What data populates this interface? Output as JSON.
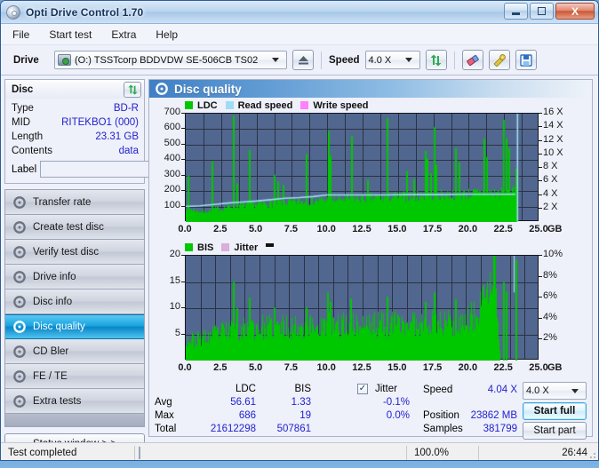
{
  "window": {
    "title": "Opti Drive Control 1.70",
    "icon": "disc-icon",
    "minimize": "–",
    "maximize": "□",
    "close": "X"
  },
  "menu": [
    "File",
    "Start test",
    "Extra",
    "Help"
  ],
  "toolbar": {
    "drive_label": "Drive",
    "drive_value": "(O:)  TSSTcorp BDDVDW SE-506CB TS02",
    "eject_icon": "eject-icon",
    "speed_label": "Speed",
    "speed_value": "4.0 X",
    "refresh_icon": "refresh-icon",
    "eraser_icon": "eraser-icon",
    "tools_icon": "tools-icon",
    "save_icon": "save-icon"
  },
  "disc_panel": {
    "header": "Disc",
    "refresh_icon": "refresh-icon",
    "rows": [
      {
        "key": "Type",
        "value": "BD-R"
      },
      {
        "key": "MID",
        "value": "RITEKBO1 (000)"
      },
      {
        "key": "Length",
        "value": "23.31 GB"
      },
      {
        "key": "Contents",
        "value": "data"
      }
    ],
    "label_key": "Label",
    "label_value": "",
    "label_placeholder": "",
    "label_button_icon": "disc-icon"
  },
  "nav": {
    "items": [
      {
        "label": "Transfer rate",
        "icon": "disc-icon",
        "selected": false
      },
      {
        "label": "Create test disc",
        "icon": "disc-icon",
        "selected": false
      },
      {
        "label": "Verify test disc",
        "icon": "disc-icon",
        "selected": false
      },
      {
        "label": "Drive info",
        "icon": "disc-icon",
        "selected": false
      },
      {
        "label": "Disc info",
        "icon": "disc-icon",
        "selected": false
      },
      {
        "label": "Disc quality",
        "icon": "disc-icon",
        "selected": true
      },
      {
        "label": "CD Bler",
        "icon": "disc-icon",
        "selected": false
      },
      {
        "label": "FE / TE",
        "icon": "disc-icon",
        "selected": false
      },
      {
        "label": "Extra tests",
        "icon": "disc-icon",
        "selected": false
      }
    ],
    "status_window_button": "Status window > >"
  },
  "panel": {
    "title": "Disc quality",
    "icon": "disc-icon"
  },
  "stats": {
    "col_ldc": "LDC",
    "col_bis": "BIS",
    "jitter_label": "Jitter",
    "jitter_checked": true,
    "rows": [
      {
        "name": "Avg",
        "ldc": "56.61",
        "bis": "1.33",
        "jitter": "-0.1%"
      },
      {
        "name": "Max",
        "ldc": "686",
        "bis": "19",
        "jitter": "0.0%"
      },
      {
        "name": "Total",
        "ldc": "21612298",
        "bis": "507861",
        "jitter": ""
      }
    ],
    "speed_label": "Speed",
    "speed_value": "4.04 X",
    "position_label": "Position",
    "position_value": "23862 MB",
    "samples_label": "Samples",
    "samples_value": "381799",
    "speed_select": "4.0 X",
    "start_full": "Start full",
    "start_part": "Start part"
  },
  "statusbar": {
    "text": "Test completed",
    "percent": "100.0%",
    "progress": 100,
    "time": "26:44"
  },
  "colors": {
    "ldc": "#00c800",
    "read_speed": "#9fdcf4",
    "write_speed": "#ff80ff",
    "bis": "#00c800",
    "jitter": "#d9b0d9",
    "plot_bg": "#51678f",
    "grid": "#2a3244",
    "accent": "#2222cc"
  },
  "chart_data": [
    {
      "type": "area",
      "id": "ldc-chart",
      "title": "LDC / Read speed / Write speed",
      "legend": [
        {
          "name": "LDC",
          "color": "#00c800"
        },
        {
          "name": "Read speed",
          "color": "#9fdcf4"
        },
        {
          "name": "Write speed",
          "color": "#ff80ff"
        }
      ],
      "legend_position": "top-left",
      "grid": true,
      "xlabel": "GB",
      "xlim": [
        0,
        25
      ],
      "xticks": [
        "0.0",
        "2.5",
        "5.0",
        "7.5",
        "10.0",
        "12.5",
        "15.0",
        "17.5",
        "20.0",
        "22.5",
        "25.0"
      ],
      "ylabel": "LDC",
      "ylim": [
        0,
        700
      ],
      "yticks": [
        100,
        200,
        300,
        400,
        500,
        600,
        700
      ],
      "y2label": "Speed",
      "y2lim": [
        0,
        16
      ],
      "y2ticks": [
        "2 X",
        "4 X",
        "6 X",
        "8 X",
        "10 X",
        "12 X",
        "14 X",
        "16 X"
      ],
      "data_end_gb": 23.4,
      "series": [
        {
          "name": "LDC",
          "color": "#00c800",
          "baseline": [
            95,
            82,
            70,
            68,
            72,
            80,
            88,
            95,
            100,
            105,
            108,
            112,
            115,
            118,
            120,
            122,
            124,
            126,
            128,
            130,
            132,
            134,
            136,
            138,
            140,
            142,
            144,
            146,
            148,
            150,
            152,
            154,
            155,
            157,
            158,
            160,
            161,
            163,
            164,
            166,
            167,
            169,
            170,
            172,
            173,
            175,
            176,
            178,
            179,
            181,
            182,
            184,
            185,
            186,
            187,
            188,
            189,
            190,
            191,
            192
          ],
          "spikes": [
            {
              "gb": 0.15,
              "value": 300
            },
            {
              "gb": 1.85,
              "value": 392
            },
            {
              "gb": 3.35,
              "value": 688
            },
            {
              "gb": 3.6,
              "value": 250
            },
            {
              "gb": 4.45,
              "value": 465
            },
            {
              "gb": 6.2,
              "value": 305
            },
            {
              "gb": 6.45,
              "value": 262
            },
            {
              "gb": 6.85,
              "value": 240
            },
            {
              "gb": 8.5,
              "value": 440
            },
            {
              "gb": 10.05,
              "value": 588
            },
            {
              "gb": 10.2,
              "value": 430
            },
            {
              "gb": 11.7,
              "value": 555
            },
            {
              "gb": 12.8,
              "value": 275
            },
            {
              "gb": 14.2,
              "value": 672
            },
            {
              "gb": 15.6,
              "value": 330
            },
            {
              "gb": 16.05,
              "value": 280
            },
            {
              "gb": 16.9,
              "value": 460
            },
            {
              "gb": 17.05,
              "value": 410
            },
            {
              "gb": 17.25,
              "value": 315
            },
            {
              "gb": 17.5,
              "value": 612
            },
            {
              "gb": 17.65,
              "value": 370
            },
            {
              "gb": 19.05,
              "value": 478
            },
            {
              "gb": 19.3,
              "value": 385
            },
            {
              "gb": 21.05,
              "value": 540
            },
            {
              "gb": 21.2,
              "value": 420
            },
            {
              "gb": 22.45,
              "value": 660
            },
            {
              "gb": 22.6,
              "value": 540
            },
            {
              "gb": 22.8,
              "value": 478
            },
            {
              "gb": 23.3,
              "value": 345
            }
          ]
        },
        {
          "name": "Read speed",
          "color": "#9fdcf4",
          "values_x_gb": [
            0,
            1,
            2,
            3,
            4,
            5,
            6,
            7,
            8,
            9,
            10,
            11,
            12,
            14,
            16,
            18,
            20,
            22,
            23.3
          ],
          "values_speed_x": [
            2.3,
            2.4,
            2.6,
            2.8,
            2.95,
            3.1,
            3.3,
            3.5,
            3.6,
            3.75,
            4.0,
            4.0,
            4.0,
            4.0,
            4.05,
            4.05,
            4.1,
            4.1,
            4.1
          ],
          "final_vertical_spike_gb": 23.45,
          "final_vertical_spike_speed": 16.0
        },
        {
          "name": "Write speed",
          "color": "#ff80ff",
          "values": []
        }
      ]
    },
    {
      "type": "area",
      "id": "bis-chart",
      "title": "BIS / Jitter",
      "legend": [
        {
          "name": "BIS",
          "color": "#00c800"
        },
        {
          "name": "Jitter",
          "color": "#d9b0d9"
        }
      ],
      "legend_position": "top-left",
      "grid": true,
      "xlabel": "GB",
      "xlim": [
        0,
        25
      ],
      "xticks": [
        "0.0",
        "2.5",
        "5.0",
        "7.5",
        "10.0",
        "12.5",
        "15.0",
        "17.5",
        "20.0",
        "22.5",
        "25.0"
      ],
      "ylabel": "BIS",
      "ylim": [
        0,
        20
      ],
      "yticks": [
        5,
        10,
        15,
        20
      ],
      "y2label": "Jitter",
      "y2lim": [
        0,
        10
      ],
      "y2ticks": [
        "2%",
        "4%",
        "6%",
        "8%",
        "10%"
      ],
      "data_end_gb": 23.4,
      "series": [
        {
          "name": "BIS",
          "color": "#00c800",
          "baseline": [
            4.2,
            4.0,
            4.1,
            4.3,
            4.5,
            5.0,
            5.4,
            5.6,
            5.8,
            6.0,
            6.1,
            6.2,
            6.2,
            6.3,
            6.3,
            6.4,
            6.4,
            6.4,
            6.5,
            6.5,
            6.5,
            6.6,
            6.6,
            6.6,
            6.6,
            6.7,
            6.7,
            6.7,
            6.8,
            6.8,
            6.8,
            6.8,
            6.9,
            6.9,
            6.9,
            7.0,
            7.0,
            7.0,
            7.0,
            7.1,
            7.1,
            7.1,
            7.2,
            7.2,
            7.2,
            7.3,
            7.3,
            7.4,
            7.5,
            7.6,
            7.8,
            8.2,
            9.0,
            10.5,
            13.0,
            19.2,
            0,
            0,
            0,
            0
          ],
          "spikes": [
            {
              "gb": 3.35,
              "value": 15.1
            },
            {
              "gb": 3.6,
              "value": 10.0
            },
            {
              "gb": 4.45,
              "value": 12.0
            },
            {
              "gb": 6.2,
              "value": 10.1
            },
            {
              "gb": 8.5,
              "value": 10.2
            },
            {
              "gb": 10.0,
              "value": 13.0
            },
            {
              "gb": 10.15,
              "value": 11.2
            },
            {
              "gb": 11.65,
              "value": 11.8
            },
            {
              "gb": 14.2,
              "value": 12.2
            },
            {
              "gb": 16.9,
              "value": 11.2
            },
            {
              "gb": 17.5,
              "value": 13.0
            },
            {
              "gb": 19.05,
              "value": 11.7
            },
            {
              "gb": 21.1,
              "value": 12.0
            },
            {
              "gb": 22.4,
              "value": 15.0
            },
            {
              "gb": 22.6,
              "value": 13.2
            },
            {
              "gb": 23.3,
              "value": 19.3
            }
          ]
        },
        {
          "name": "Jitter",
          "color": "#d9b0d9",
          "values": []
        }
      ]
    }
  ]
}
